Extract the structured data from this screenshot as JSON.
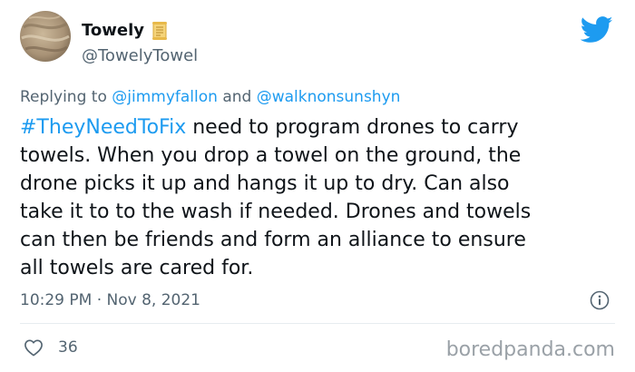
{
  "author": {
    "display_name": "Towely",
    "handle": "@TowelyTowel",
    "avatar_icon": "towel-photo-avatar",
    "badge_icon": "scroll-emoji-icon"
  },
  "reply": {
    "prefix": "Replying to",
    "mention_1": "@jimmyfallon",
    "joiner": "and",
    "mention_2": "@walknonsunshyn"
  },
  "tweet": {
    "hashtag": "#TheyNeedToFix",
    "line_1_rest": " need to program drones to carry",
    "line_2": "towels. When you drop a towel on the ground, the",
    "line_3": "drone picks it up and hangs it up to dry. Can also",
    "line_4": "take it to to the wash if needed. Drones and towels",
    "line_5": "can then be friends and form an alliance to ensure",
    "line_6": "all towels are cared for."
  },
  "meta": {
    "timestamp": "10:29 PM · Nov 8, 2021"
  },
  "engagement": {
    "likes": "36"
  },
  "watermark": "boredpanda.com",
  "colors": {
    "accent": "#1d9bf0",
    "secondary_text": "#536471",
    "primary_text": "#0f1419"
  }
}
